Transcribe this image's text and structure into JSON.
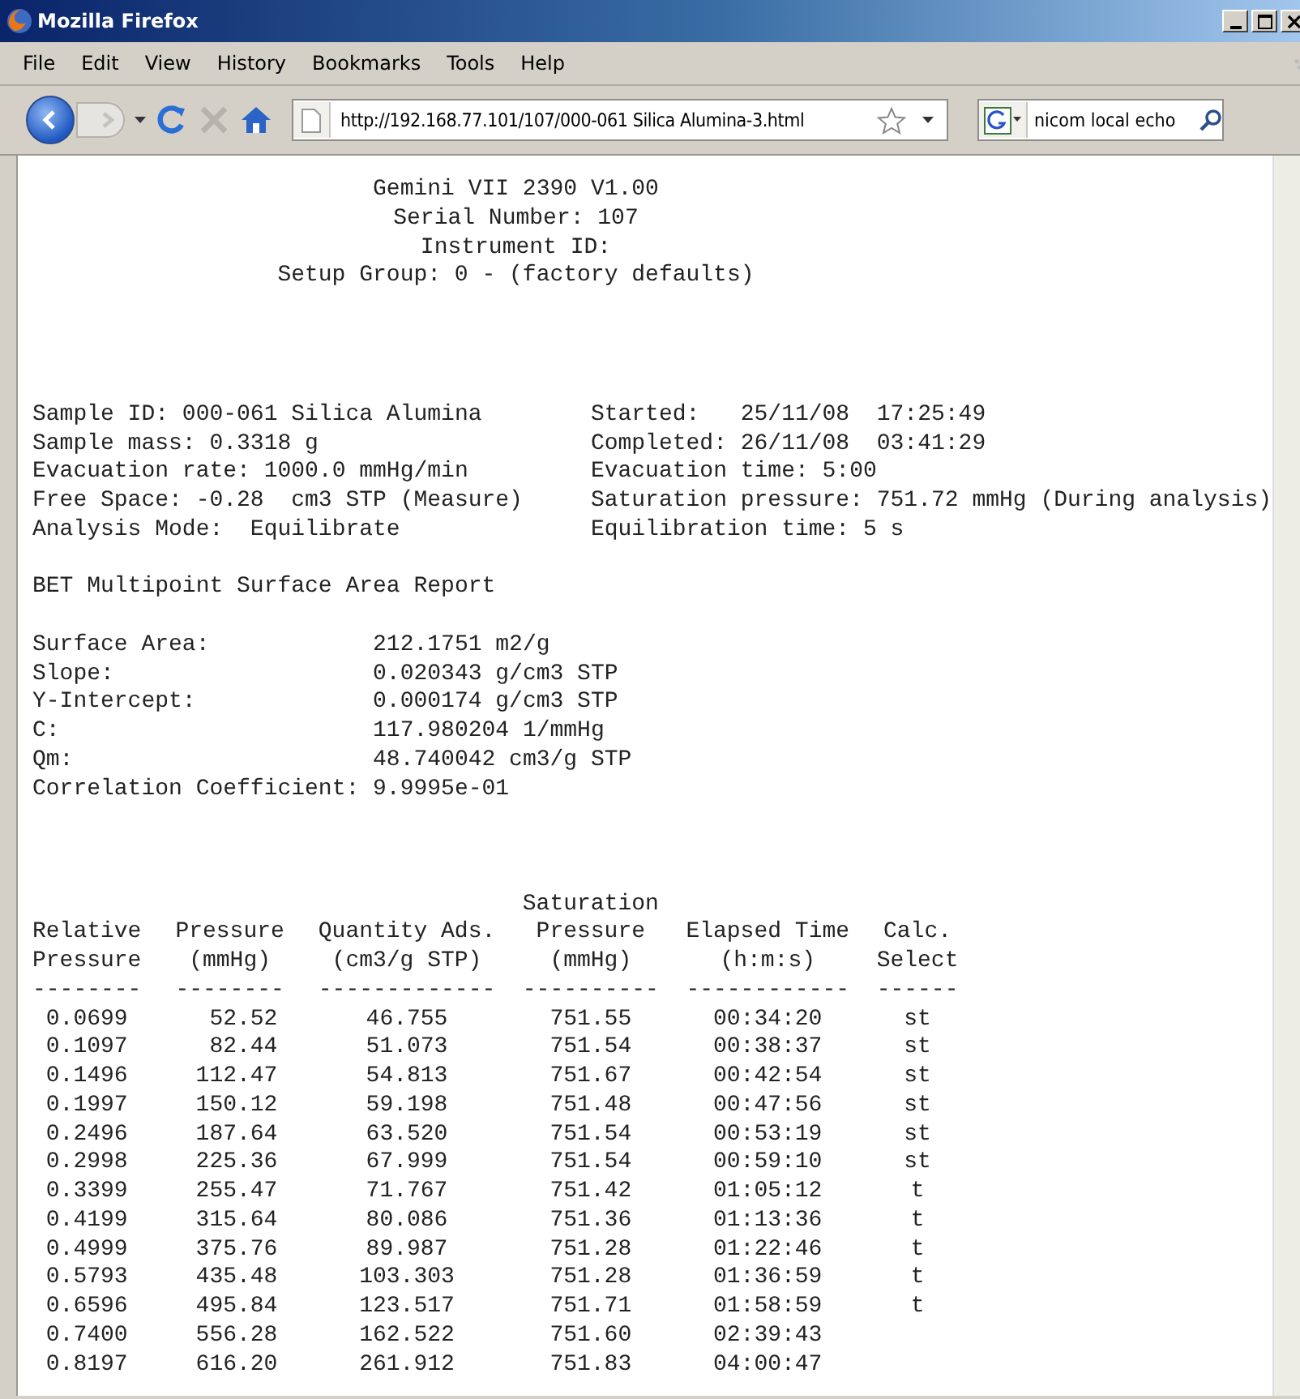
{
  "window": {
    "title": "Mozilla Firefox"
  },
  "menu": [
    "File",
    "Edit",
    "View",
    "History",
    "Bookmarks",
    "Tools",
    "Help"
  ],
  "toolbar": {
    "forward_disabled": true,
    "url": "http://192.168.77.101/107/000-061 Silica Alumina-3.html",
    "search": "nicom local echo"
  },
  "report": {
    "header": [
      "Gemini VII 2390 V1.00",
      "Serial Number: 107",
      "Instrument ID:",
      "Setup Group: 0 - (factory defaults)"
    ],
    "info_left": [
      "Sample ID: 000-061 Silica Alumina",
      "Sample mass: 0.3318 g",
      "Evacuation rate: 1000.0 mmHg/min",
      "Free Space: -0.28  cm3 STP (Measure)",
      "Analysis Mode:  Equilibrate"
    ],
    "info_right": [
      "Started:   25/11/08  17:25:49",
      "Completed: 26/11/08  03:41:29",
      "Evacuation time: 5:00",
      "Saturation pressure: 751.72 mmHg (During analysis)",
      "Equilibration time: 5 s"
    ],
    "section_title": "BET Multipoint Surface Area Report",
    "results": [
      {
        "label": "Surface Area:",
        "value": "212.1751 m2/g"
      },
      {
        "label": "Slope:",
        "value": "0.020343 g/cm3 STP"
      },
      {
        "label": "Y-Intercept:",
        "value": "0.000174 g/cm3 STP"
      },
      {
        "label": "C:",
        "value": "117.980204 1/mmHg"
      },
      {
        "label": "Qm:",
        "value": "48.740042 cm3/g STP"
      },
      {
        "label": "Correlation Coefficient:",
        "value": "9.9995e-01"
      }
    ],
    "table": {
      "columns": [
        {
          "heading": [
            "Relative",
            "Pressure"
          ],
          "rule": "--------"
        },
        {
          "heading": [
            "Pressure",
            "(mmHg)"
          ],
          "rule": "--------"
        },
        {
          "heading": [
            "Quantity Ads.",
            "(cm3/g STP)"
          ],
          "rule": "-------------"
        },
        {
          "heading": [
            "Saturation",
            "Pressure",
            "(mmHg)"
          ],
          "rule": "----------"
        },
        {
          "heading": [
            "Elapsed Time",
            "(h:m:s)"
          ],
          "rule": "------------"
        },
        {
          "heading": [
            "Calc.",
            "Select"
          ],
          "rule": "------"
        }
      ],
      "rows": [
        [
          "0.0699",
          "52.52",
          "46.755",
          "751.55",
          "00:34:20",
          "st"
        ],
        [
          "0.1097",
          "82.44",
          "51.073",
          "751.54",
          "00:38:37",
          "st"
        ],
        [
          "0.1496",
          "112.47",
          "54.813",
          "751.67",
          "00:42:54",
          "st"
        ],
        [
          "0.1997",
          "150.12",
          "59.198",
          "751.48",
          "00:47:56",
          "st"
        ],
        [
          "0.2496",
          "187.64",
          "63.520",
          "751.54",
          "00:53:19",
          "st"
        ],
        [
          "0.2998",
          "225.36",
          "67.999",
          "751.54",
          "00:59:10",
          "st"
        ],
        [
          "0.3399",
          "255.47",
          "71.767",
          "751.42",
          "01:05:12",
          "t"
        ],
        [
          "0.4199",
          "315.64",
          "80.086",
          "751.36",
          "01:13:36",
          "t"
        ],
        [
          "0.4999",
          "375.76",
          "89.987",
          "751.28",
          "01:22:46",
          "t"
        ],
        [
          "0.5793",
          "435.48",
          "103.303",
          "751.28",
          "01:36:59",
          "t"
        ],
        [
          "0.6596",
          "495.84",
          "123.517",
          "751.71",
          "01:58:59",
          "t"
        ],
        [
          "0.7400",
          "556.28",
          "162.522",
          "751.60",
          "02:39:43"
        ],
        [
          "0.8197",
          "616.20",
          "261.912",
          "751.83",
          "04:00:47"
        ]
      ]
    }
  }
}
